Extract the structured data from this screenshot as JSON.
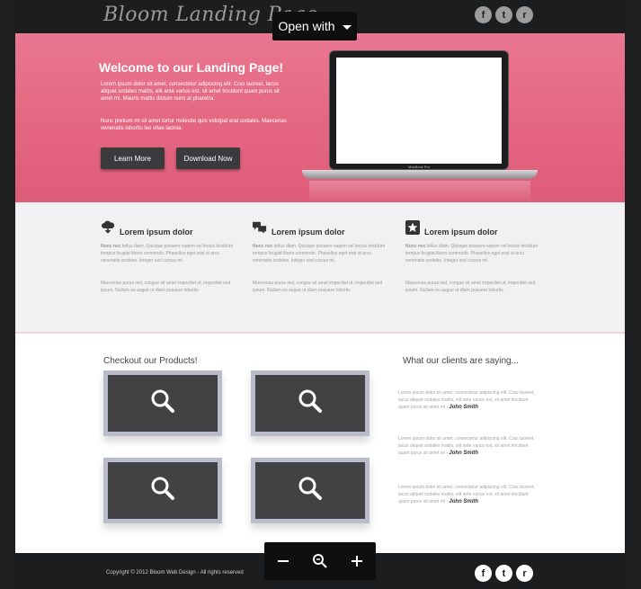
{
  "viewer": {
    "open_with_label": "Open with"
  },
  "site": {
    "logo": "Bloom Landing Page",
    "social_icons": [
      "facebook-icon",
      "twitter-icon",
      "rss-icon"
    ]
  },
  "hero": {
    "title": "Welcome to our Landing Page!",
    "paragraph1": "Lorem ipsum dolor sit amet, consectetur adipiscing elit. Cras laoreet, lacus aliquet sodales mattis, elit ante varius est, sit amet tincidunt quam purus sit amet mi. Mauris mattis dictum nunc at pharetra.",
    "paragraph2": "Nunc pretium mi sit amet tortor molestie quis volutpat erat sodales. Maecenas venenatis lobortis leo vitae lacinia.",
    "learn_more_label": "Learn More",
    "download_label": "Download Now",
    "laptop_brand": "MacBook Pro"
  },
  "features": [
    {
      "title": "Lorem ipsum dolor",
      "icon": "cloud-download-icon",
      "lead": "Nunc nec",
      "text": " tellus diam. Quisque posuere sapien vel lectus tincidunt tempus feugiat libero commodo. Phasellus eget erat ut arcu venenatis sodales. Integer sed cursus mi.",
      "text2": "Maecenas purus nisl, congue sit amet imperdiet ut, imperdiet sed ipsum. Nullam eu augue ut diam posuere lobortis."
    },
    {
      "title": "Lorem ipsum dolor",
      "icon": "chat-bubbles-icon",
      "lead": "Nunc nec",
      "text": " tellus diam. Quisque posuere sapien vel lectus tincidunt tempus feugiat libero commodo. Phasellus eget erat ut arcu venenatis sodales. Integer sed cursus mi.",
      "text2": "Maecenas purus nisl, congue sit amet imperdiet ut, imperdiet sed ipsum. Nullam eu augue ut diam posuere lobortis."
    },
    {
      "title": "Lorem ipsum dolor",
      "icon": "star-icon",
      "lead": "Nunc nec",
      "text": " tellus diam. Quisque posuere sapien vel lectus tincidunt tempus feugiat libero commodo. Phasellus eget erat ut arcu venenatis sodales. Integer sed cursus mi.",
      "text2": "Maecenas purus nisl, congue sit amet imperdiet ut, imperdiet sed ipsum. Nullam eu augue ut diam posuere lobortis."
    }
  ],
  "products": {
    "title": "Checkout our Products!",
    "items": [
      "magnifier-icon",
      "magnifier-icon",
      "magnifier-icon",
      "magnifier-icon"
    ]
  },
  "clients": {
    "title": "What our clients are saying...",
    "testimonials": [
      {
        "text": "Lorem ipsum dolor sit amet, consectetur adipiscing elit. Cras laoreet, lacus aliquet sodales mattis, elit ante varius est, sit amet tincidunt quam purus sit amet mi - ",
        "author": "John Smith"
      },
      {
        "text": "Lorem ipsum dolor sit amet, consectetur adipiscing elit. Cras laoreet, lacus aliquet sodales mattis, elit ante varius est, sit amet tincidunt quam purus sit amet mi - ",
        "author": "John Smith"
      },
      {
        "text": "Lorem ipsum dolor sit amet, consectetur adipiscing elit. Cras laoreet, lacus aliquet sodales mattis, elit ante varius est, sit amet tincidunt quam purus sit amet mi - ",
        "author": "John Smith"
      }
    ]
  },
  "footer": {
    "copyright": "Copyright © 2012 Bloom Web Design - All rights reserved"
  },
  "colors": {
    "hero_pink": "#e4657f",
    "dark_bar": "#1c1d1f",
    "button_dark": "#3b3b3d",
    "product_frame": "#b8bccb"
  }
}
